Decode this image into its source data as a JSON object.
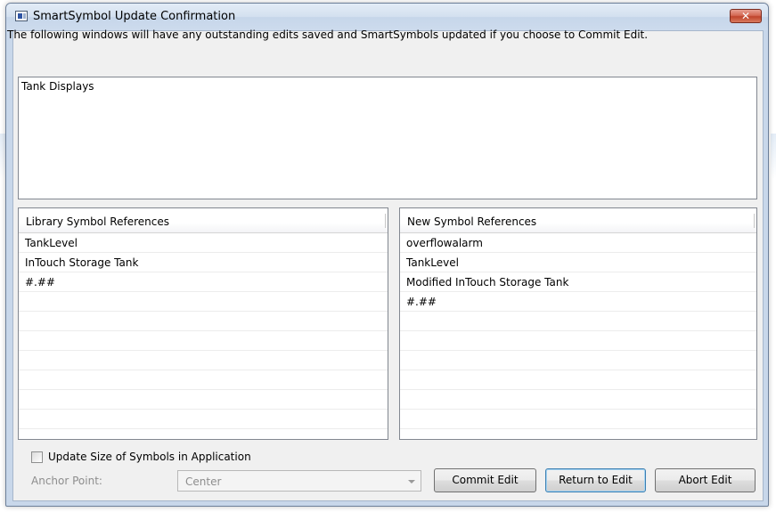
{
  "window": {
    "title": "SmartSymbol Update Confirmation",
    "close_glyph": "✕"
  },
  "instruction": "The following windows will have any outstanding edits saved and SmartSymbols updated if you choose to Commit Edit.",
  "windows_list": {
    "items": [
      "Tank Displays"
    ]
  },
  "library_refs": {
    "header": "Library Symbol References",
    "rows": [
      "TankLevel",
      "InTouch Storage Tank",
      "#.##",
      "",
      "",
      "",
      "",
      "",
      "",
      "",
      ""
    ]
  },
  "new_refs": {
    "header": "New Symbol References",
    "rows": [
      "overflowalarm",
      "TankLevel",
      "Modified InTouch Storage Tank",
      "#.##",
      "",
      "",
      "",
      "",
      "",
      "",
      ""
    ]
  },
  "options": {
    "update_size_label": "Update Size of Symbols in Application",
    "update_size_checked": false,
    "anchor_label": "Anchor Point:",
    "anchor_value": "Center"
  },
  "buttons": {
    "commit": "Commit Edit",
    "return": "Return to Edit",
    "abort": "Abort Edit"
  },
  "icons": {
    "window_icon": "window-app-icon",
    "close": "close-icon",
    "dropdown": "chevron-down-icon"
  }
}
